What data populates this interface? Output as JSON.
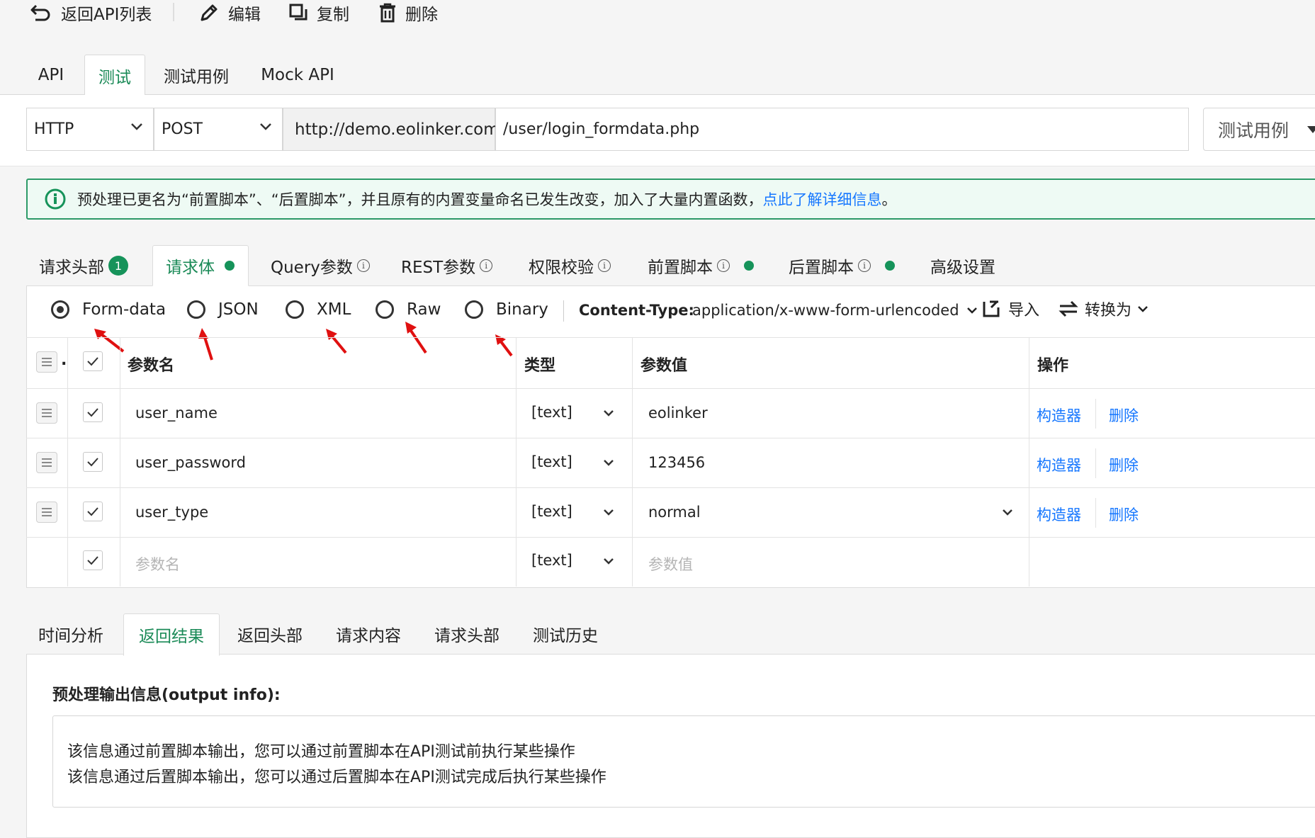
{
  "toolbar": {
    "back": "返回API列表",
    "edit": "编辑",
    "copy": "复制",
    "delete": "删除"
  },
  "main_tabs": [
    "API",
    "测试",
    "测试用例",
    "Mock API"
  ],
  "request_line": {
    "protocol": "HTTP",
    "method": "POST",
    "host": "http://demo.eolinker.com",
    "path": "/user/login_formdata.php",
    "test_case_select": "测试用例"
  },
  "banner": {
    "text": "预处理已更名为“前置脚本”、“后置脚本”，并且原有的内置变量命名已发生改变，加入了大量内置函数，",
    "link": "点此了解详细信息",
    "end": "。"
  },
  "request_tabs": {
    "headers": "请求头部",
    "headers_count": "1",
    "body": "请求体",
    "query": "Query参数",
    "rest": "REST参数",
    "auth": "权限校验",
    "pre_script": "前置脚本",
    "post_script": "后置脚本",
    "advanced": "高级设置"
  },
  "body_types": {
    "form_data": "Form-data",
    "json": "JSON",
    "xml": "XML",
    "raw": "Raw",
    "binary": "Binary",
    "selected": "Form-data"
  },
  "content_type": {
    "label": "Content-Type:",
    "value": "application/x-www-form-urlencoded"
  },
  "actions": {
    "import": "导入",
    "convert": "转换为"
  },
  "table": {
    "headers": {
      "name": "参数名",
      "type": "类型",
      "value": "参数值",
      "ops": "操作"
    },
    "rows": [
      {
        "name": "user_name",
        "type": "[text]",
        "value": "eolinker",
        "builder": "构造器",
        "delete": "删除"
      },
      {
        "name": "user_password",
        "type": "[text]",
        "value": "123456",
        "builder": "构造器",
        "delete": "删除"
      },
      {
        "name": "user_type",
        "type": "[text]",
        "value": "normal",
        "builder": "构造器",
        "delete": "删除"
      }
    ],
    "new_row": {
      "name_placeholder": "参数名",
      "type": "[text]",
      "value_placeholder": "参数值"
    }
  },
  "result_tabs": [
    "时间分析",
    "返回结果",
    "返回头部",
    "请求内容",
    "请求头部",
    "测试历史"
  ],
  "output": {
    "title": "预处理输出信息(output info):",
    "line1": "该信息通过前置脚本输出，您可以通过前置脚本在API测试前执行某些操作",
    "line2": "该信息通过后置脚本输出，您可以通过后置脚本在API测试完成后执行某些操作"
  },
  "colors": {
    "accent_green": "#16935a",
    "link_blue": "#1677ff",
    "annotation_red": "#e01010"
  }
}
